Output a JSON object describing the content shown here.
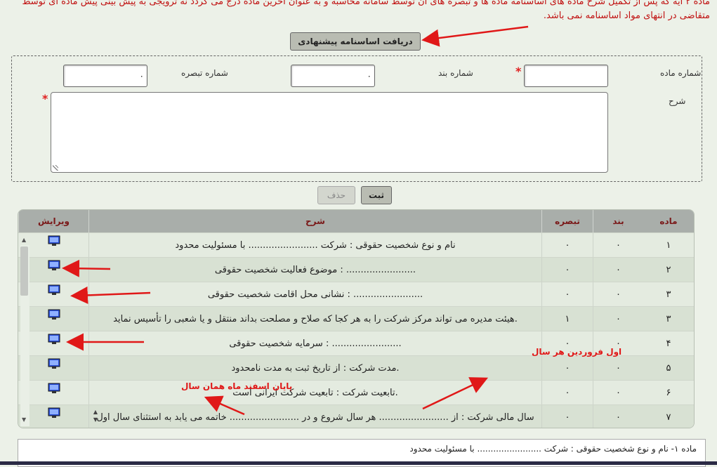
{
  "notice": {
    "line1": "ماده ۲ آیه که پس از تکمیل شرح ماده های اساسنامه ماده ها و تبصره های آن توسط سامانه محاسبه و به عنوان آخرین ماده درج می گردد نه ترویجی به پیش بینی پیش ماده ای توسط",
    "line2": "متقاضی در انتهای مواد اساسنامه نمی باشد."
  },
  "toolbar": {
    "proposed_label": "دریافت اساسنامه پیشنهادی",
    "submit_label": "ثبت",
    "delete_label": "حذف"
  },
  "form": {
    "article_label": "شماره ماده",
    "clause_label": "شماره بند",
    "note_label": "شماره تبصره",
    "description_label": "شرح",
    "clause_value": "۰",
    "note_value": "۰",
    "required_mark": "*"
  },
  "grid": {
    "columns": {
      "article": "ماده",
      "clause": "بند",
      "note": "تبصره",
      "description": "شرح",
      "edit": "ویرایش"
    },
    "rows": [
      {
        "article": "۱",
        "clause": "۰",
        "note": "۰",
        "description": "نام و نوع شخصیت حقوقی : شرکت ........................ با مسئولیت محدود"
      },
      {
        "article": "۲",
        "clause": "۰",
        "note": "۰",
        "description": "موضوع فعالیت شخصیت حقوقی : ........................"
      },
      {
        "article": "۳",
        "clause": "۰",
        "note": "۰",
        "description": "نشانی محل اقامت شخصیت حقوقی : ........................"
      },
      {
        "article": "۳",
        "clause": "۰",
        "note": "۱",
        "description": "هیئت مدیره می تواند مرکز شرکت را به هر کجا که صلاح و مصلحت بداند منتقل و یا شعبی را تأسیس نماید."
      },
      {
        "article": "۴",
        "clause": "۰",
        "note": "۰",
        "description": "سرمایه شخصیت حقوقی : ........................"
      },
      {
        "article": "۵",
        "clause": "۰",
        "note": "۰",
        "description": "مدت شرکت : از تاریخ ثبت به مدت نامحدود."
      },
      {
        "article": "۶",
        "clause": "۰",
        "note": "۰",
        "description": "تابعیت شرکت : تابعیت شرکت ایرانی است."
      },
      {
        "article": "۷",
        "clause": "۰",
        "note": "۰",
        "description": "سال مالی شرکت : از ........................ هر سال شروع و در ........................ خاتمه می یابد به استثنای سال اول"
      }
    ]
  },
  "annotations": {
    "first_farvardin": "اول فروردین هر سال",
    "end_esfand": "پایان اسفند ماه همان سال"
  },
  "preview": {
    "text": "ماده ۱- نام و نوع شخصیت حقوقی : شرکت ........................ با مسئولیت محدود"
  },
  "colors": {
    "background": "#ecf1e8",
    "annotation_red": "#e01818",
    "header_text": "#7a1818"
  }
}
